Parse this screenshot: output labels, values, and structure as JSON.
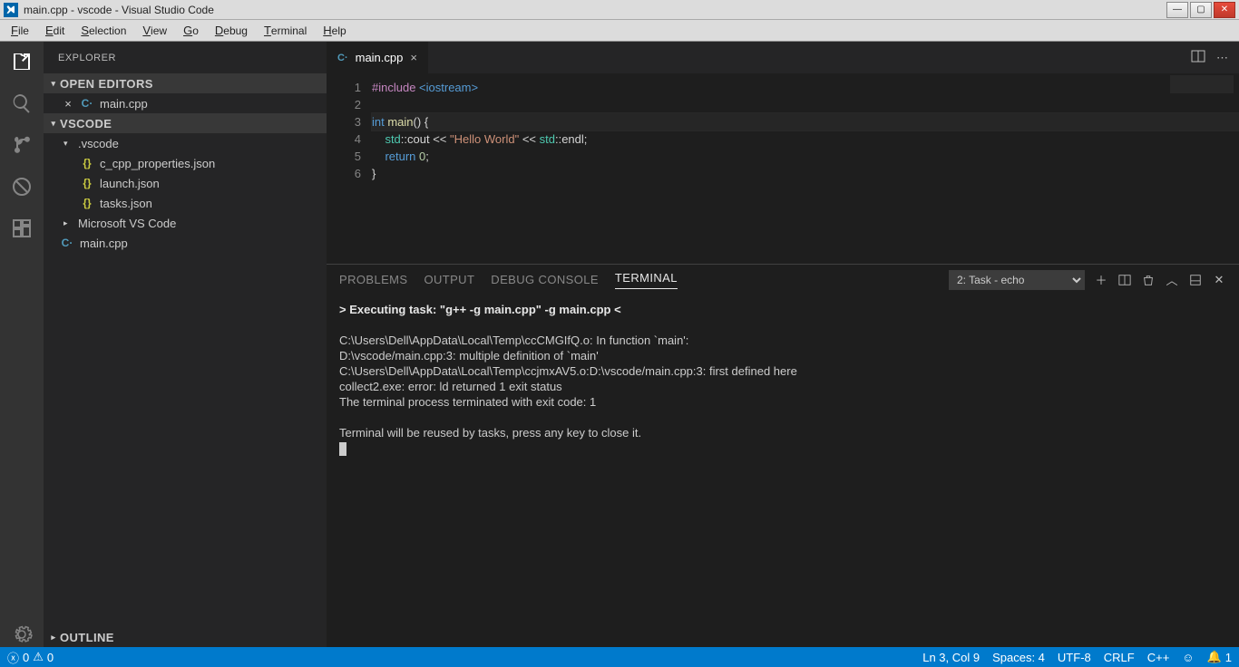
{
  "window": {
    "title": "main.cpp - vscode - Visual Studio Code"
  },
  "menu": [
    "File",
    "Edit",
    "Selection",
    "View",
    "Go",
    "Debug",
    "Terminal",
    "Help"
  ],
  "sidebar": {
    "title": "EXPLORER",
    "sections": {
      "openEditors": {
        "label": "OPEN EDITORS",
        "items": [
          {
            "close": "×",
            "icon": "C·",
            "label": "main.cpp"
          }
        ]
      },
      "workspace": {
        "label": "VSCODE",
        "tree": [
          {
            "type": "folder",
            "expanded": true,
            "label": ".vscode",
            "children": [
              {
                "type": "file",
                "icon": "{}",
                "label": "c_cpp_properties.json"
              },
              {
                "type": "file",
                "icon": "{}",
                "label": "launch.json"
              },
              {
                "type": "file",
                "icon": "{}",
                "label": "tasks.json"
              }
            ]
          },
          {
            "type": "folder",
            "expanded": false,
            "label": "Microsoft VS Code"
          },
          {
            "type": "file",
            "icon": "C·",
            "label": "main.cpp"
          }
        ]
      },
      "outline": {
        "label": "OUTLINE"
      }
    }
  },
  "tabs": [
    {
      "icon": "C·",
      "label": "main.cpp",
      "dirty": false
    }
  ],
  "editor": {
    "lines": [
      {
        "n": 1,
        "segs": [
          [
            "#include ",
            "tok-pp"
          ],
          [
            "<iostream>",
            "tok-inc"
          ]
        ]
      },
      {
        "n": 2,
        "segs": []
      },
      {
        "n": 3,
        "current": true,
        "segs": [
          [
            "int ",
            "tok-kw"
          ],
          [
            "main",
            "tok-fn"
          ],
          [
            "(",
            "tok-punc"
          ],
          [
            ")",
            "tok-punc cursor-after"
          ],
          [
            " {",
            "tok-punc"
          ]
        ]
      },
      {
        "n": 4,
        "segs": [
          [
            "    std",
            "tok-ns"
          ],
          [
            "::",
            "tok-op"
          ],
          [
            "cout ",
            "tok-punc"
          ],
          [
            "<< ",
            "tok-op"
          ],
          [
            "\"Hello World\"",
            "tok-str"
          ],
          [
            " << ",
            "tok-op"
          ],
          [
            "std",
            "tok-ns"
          ],
          [
            "::",
            "tok-op"
          ],
          [
            "endl;",
            "tok-punc"
          ]
        ]
      },
      {
        "n": 5,
        "segs": [
          [
            "    ",
            ""
          ],
          [
            "return ",
            "tok-kw"
          ],
          [
            "0",
            "tok-num"
          ],
          [
            ";",
            "tok-punc"
          ]
        ]
      },
      {
        "n": 6,
        "segs": [
          [
            "}",
            "tok-punc"
          ]
        ]
      }
    ]
  },
  "panel": {
    "tabs": [
      "PROBLEMS",
      "OUTPUT",
      "DEBUG CONSOLE",
      "TERMINAL"
    ],
    "active": 3,
    "taskSelect": "2: Task - echo",
    "terminal": {
      "exec_prefix": "> Executing task: ",
      "exec_cmd": "\"g++ -g main.cpp\" -g main.cpp <",
      "lines": [
        "",
        "C:\\Users\\Dell\\AppData\\Local\\Temp\\ccCMGIfQ.o: In function `main':",
        "D:\\vscode/main.cpp:3: multiple definition of `main'",
        "C:\\Users\\Dell\\AppData\\Local\\Temp\\ccjmxAV5.o:D:\\vscode/main.cpp:3: first defined here",
        "collect2.exe: error: ld returned 1 exit status",
        "The terminal process terminated with exit code: 1",
        "",
        "Terminal will be reused by tasks, press any key to close it."
      ]
    }
  },
  "status": {
    "errors": "0",
    "warnings": "0",
    "lncol": "Ln 3, Col 9",
    "spaces": "Spaces: 4",
    "encoding": "UTF-8",
    "eol": "CRLF",
    "lang": "C++",
    "bell": "1"
  }
}
